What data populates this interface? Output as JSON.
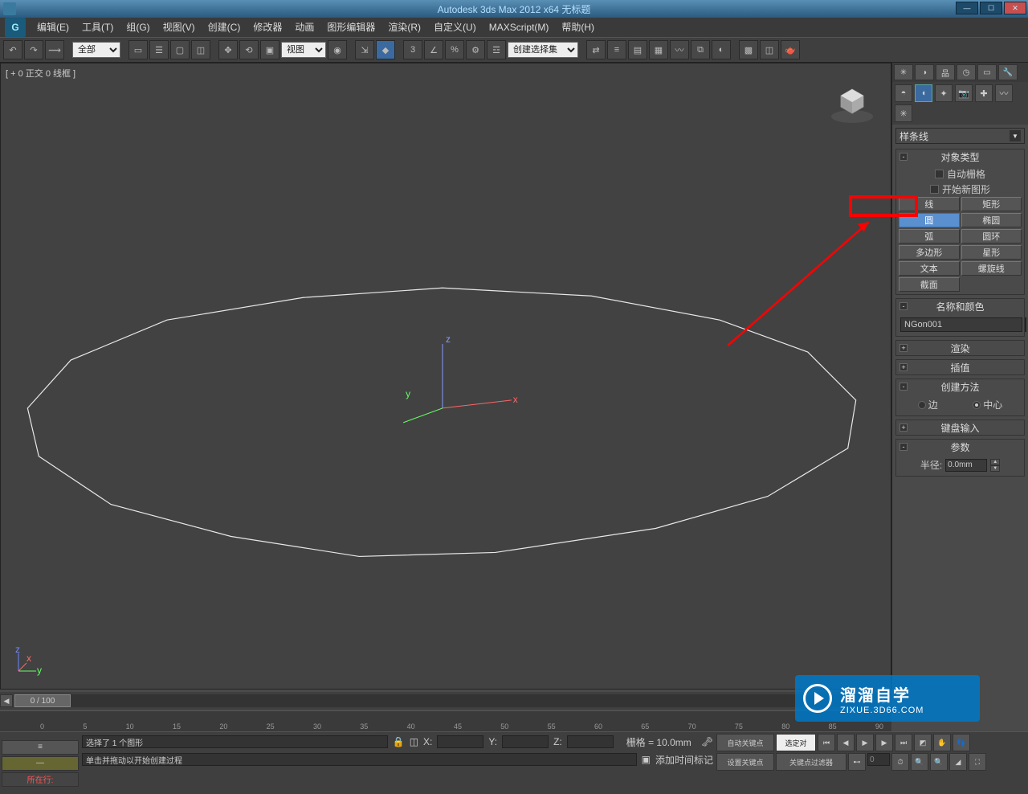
{
  "title": "Autodesk 3ds Max  2012 x64    无标题",
  "menu": [
    "编辑(E)",
    "工具(T)",
    "组(G)",
    "视图(V)",
    "创建(C)",
    "修改器",
    "动画",
    "图形编辑器",
    "渲染(R)",
    "自定义(U)",
    "MAXScript(M)",
    "帮助(H)"
  ],
  "tb_select1": "全部",
  "tb_select2": "视图",
  "tb_select3": "创建选择集",
  "viewport_label": "[ + 0 正交 0 线框 ]",
  "spline_dropdown": "样条线",
  "rollout_objtype": "对象类型",
  "auto_grid": "自动栅格",
  "start_new_shape": "开始新图形",
  "buttons": [
    [
      "线",
      "矩形"
    ],
    [
      "圆",
      "椭圆"
    ],
    [
      "弧",
      "圆环"
    ],
    [
      "多边形",
      "星形"
    ],
    [
      "文本",
      "螺旋线"
    ],
    [
      "截面",
      ""
    ]
  ],
  "rollout_namecolor": "名称和颜色",
  "obj_name": "NGon001",
  "rollout_render": "渲染",
  "rollout_interp": "插值",
  "rollout_method": "创建方法",
  "method_edge": "边",
  "method_center": "中心",
  "rollout_kb": "键盘输入",
  "rollout_params": "参数",
  "radius_label": "半径:",
  "radius_val": "0.0mm",
  "timeslider": "0 / 100",
  "ticks": [
    "0",
    "5",
    "10",
    "15",
    "20",
    "25",
    "30",
    "35",
    "40",
    "45",
    "50",
    "55",
    "60",
    "65",
    "70",
    "75",
    "80",
    "85",
    "90"
  ],
  "status_sel": "选择了 1 个图形",
  "status_prompt": "单击并拖动以开始创建过程",
  "status_location": "所在行:",
  "grid_label": "栅格 = 10.0mm",
  "auto_key": "自动关键点",
  "sel_obj": "选定对",
  "set_key": "设置关键点",
  "key_filter": "关键点过滤器",
  "add_time_tag": "添加时间标记",
  "coord_x": "X:",
  "coord_y": "Y:",
  "coord_z": "Z:",
  "frame_field": "0",
  "logo_big": "溜溜自学",
  "logo_small": "ZIXUE.3D66.COM"
}
